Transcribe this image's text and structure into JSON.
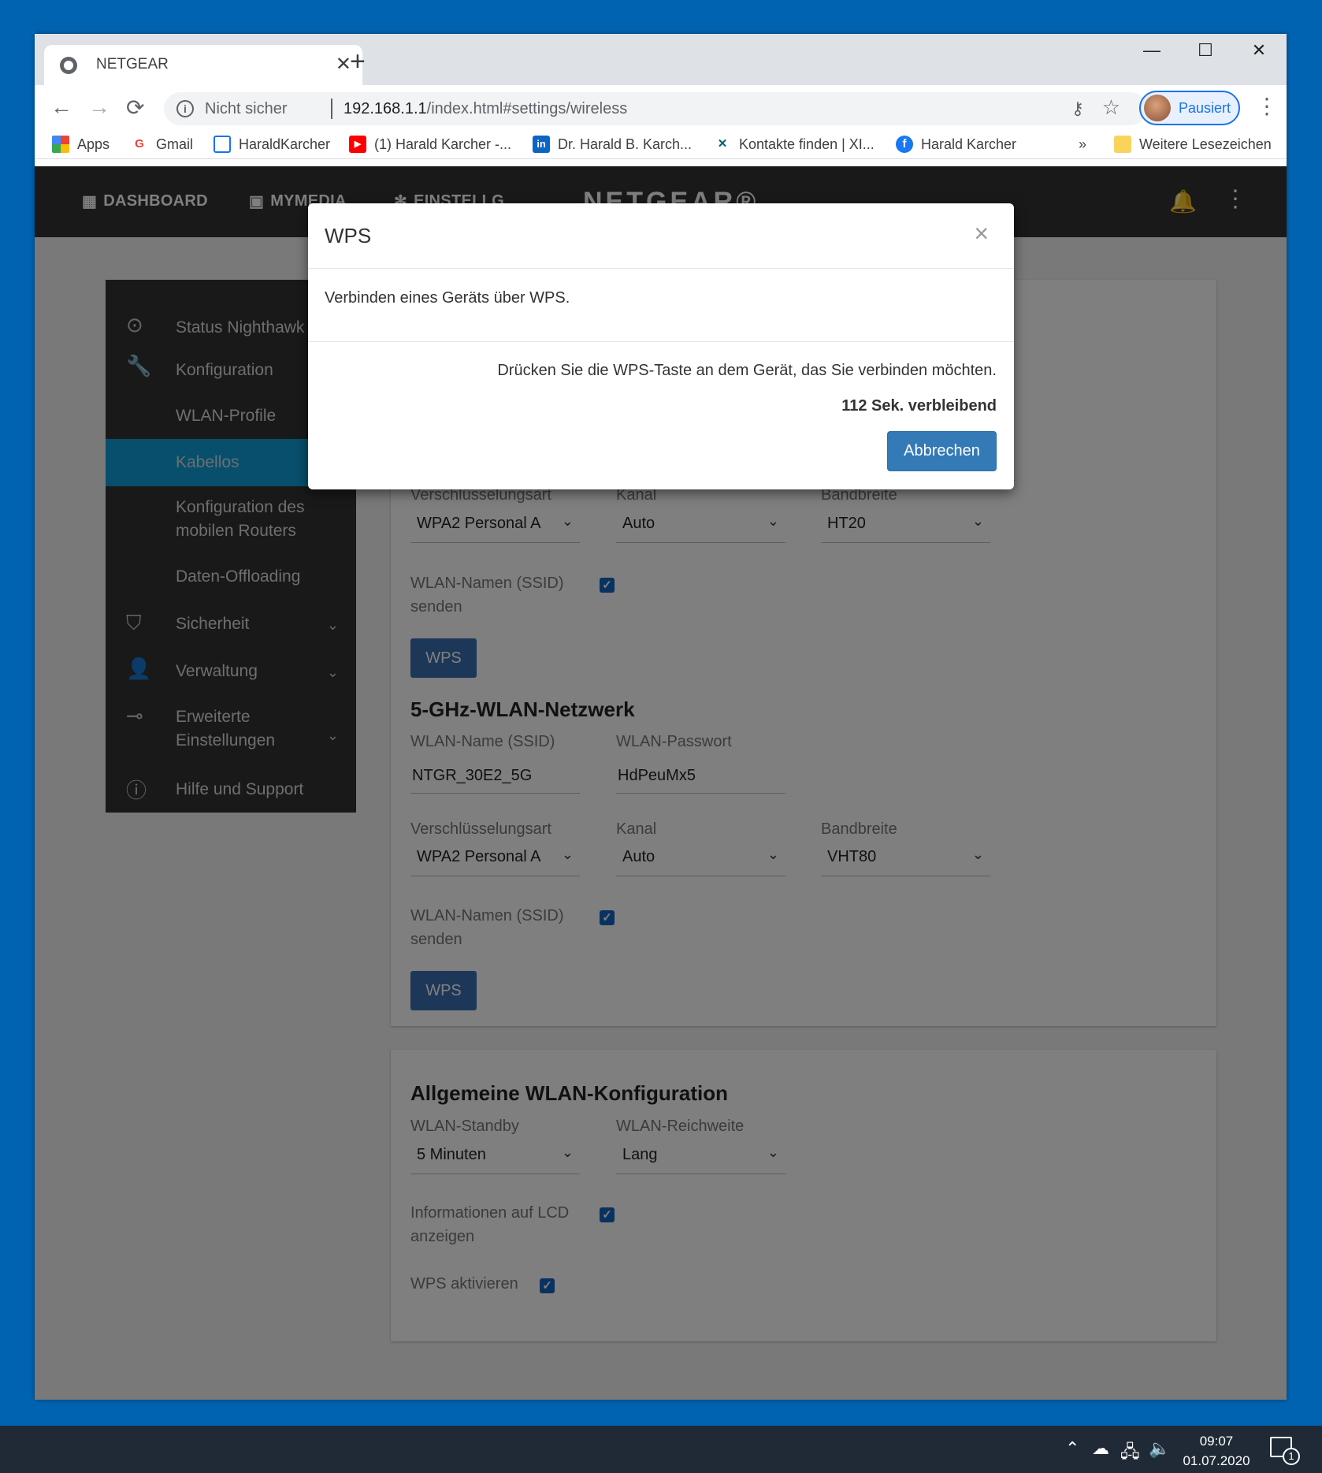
{
  "browser": {
    "tab_title": "NETGEAR",
    "tab_close": "✕",
    "new_tab": "+",
    "window_controls": {
      "minimize": "—",
      "maximize": "☐",
      "close": "✕"
    },
    "back": "←",
    "forward": "→",
    "reload": "⟳",
    "security_label": "Nicht sicher",
    "url_host": "192.168.1.1",
    "url_path": "/index.html#settings/wireless",
    "profile_label": "Pausiert",
    "menu": "⋮",
    "bookmarks": [
      {
        "label": "Apps",
        "icon": "apps-grid-icon"
      },
      {
        "label": "Gmail",
        "icon": "google-icon"
      },
      {
        "label": "HaraldKarcher",
        "icon": "page-icon"
      },
      {
        "label": "(1) Harald Karcher -...",
        "icon": "youtube-icon"
      },
      {
        "label": "Dr. Harald B. Karch...",
        "icon": "linkedin-icon"
      },
      {
        "label": "Kontakte finden | XI...",
        "icon": "xing-icon"
      },
      {
        "label": "Harald Karcher",
        "icon": "facebook-icon"
      },
      {
        "label": "»",
        "icon": ""
      },
      {
        "label": "Weitere Lesezeichen",
        "icon": "folder-icon"
      }
    ]
  },
  "appbar": {
    "nav": [
      {
        "label": "DASHBOARD",
        "icon": "dashboard-icon"
      },
      {
        "label": "MYMEDIA",
        "icon": "media-icon"
      },
      {
        "label": "EINSTELLG",
        "icon": "gear-icon"
      }
    ],
    "logo": "NETGEAR®"
  },
  "sidebar": {
    "items": [
      {
        "label": "Status Nighthawk",
        "icon": "check-circle-icon"
      },
      {
        "label": "Konfiguration",
        "icon": "wrench-icon"
      },
      {
        "label": "WLAN-Profile",
        "icon": ""
      },
      {
        "label": "Kabellos",
        "icon": "",
        "active": true
      },
      {
        "label": "Konfiguration des mobilen Routers",
        "icon": ""
      },
      {
        "label": "Daten-Offloading",
        "icon": ""
      },
      {
        "label": "Sicherheit",
        "icon": "shield-icon",
        "expandable": true
      },
      {
        "label": "Verwaltung",
        "icon": "person-icon",
        "expandable": true
      },
      {
        "label": "Erweiterte Einstellungen",
        "icon": "toggle-icon",
        "expandable": true
      },
      {
        "label": "Hilfe und Support",
        "icon": "help-icon"
      }
    ]
  },
  "wifi24": {
    "enc_label": "Verschlüsselungsart",
    "channel_label": "Kanal",
    "bw_label": "Bandbreite",
    "encryption": "WPA2 Personal A",
    "channel": "Auto",
    "bandwidth": "HT20",
    "ssid_broadcast_label": "WLAN-Namen (SSID) senden",
    "wps_button": "WPS"
  },
  "wifi5": {
    "title": "5-GHz-WLAN-Netzwerk",
    "ssid_label": "WLAN-Name (SSID)",
    "ssid": "NTGR_30E2_5G",
    "pw_label": "WLAN-Passwort",
    "password": "HdPeuMx5",
    "enc_label": "Verschlüsselungsart",
    "encryption": "WPA2 Personal A",
    "channel_label": "Kanal",
    "channel": "Auto",
    "bw_label": "Bandbreite",
    "bandwidth": "VHT80",
    "ssid_broadcast_label": "WLAN-Namen (SSID) senden",
    "wps_button": "WPS"
  },
  "general": {
    "title": "Allgemeine WLAN-Konfiguration",
    "standby_label": "WLAN-Standby",
    "standby": "5 Minuten",
    "range_label": "WLAN-Reichweite",
    "range": "Lang",
    "lcd_label": "Informationen auf LCD anzeigen",
    "wps_enable_label": "WPS aktivieren"
  },
  "modal": {
    "title": "WPS",
    "close": "×",
    "body": "Verbinden eines Geräts über WPS.",
    "message": "Drücken Sie die WPS-Taste an dem Gerät, das Sie verbinden möchten.",
    "remaining": "112 Sek. verbleibend",
    "cancel": "Abbrechen"
  },
  "taskbar": {
    "time": "09:07",
    "date": "01.07.2020",
    "notifications": "1"
  }
}
